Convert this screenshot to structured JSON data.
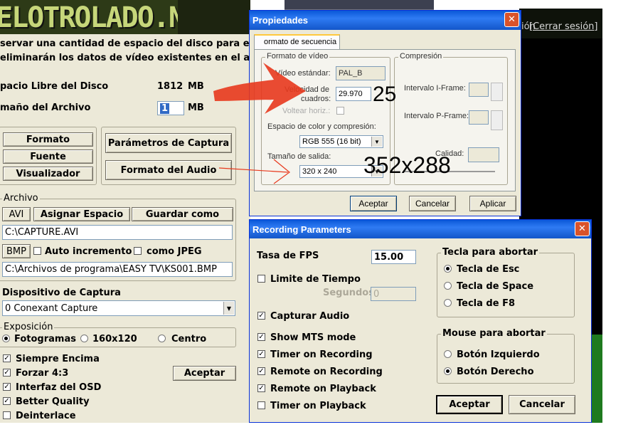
{
  "banner": {
    "text": "ELOTROLADO.NET"
  },
  "bg_link": {
    "prefix": "ión",
    "link": "[Cerrar sesión]"
  },
  "main": {
    "info_line1": "servar una cantidad de espacio del disco para el archivo",
    "info_line2": "eliminarán los datos de vídeo existentes en el archivo",
    "free_label": "pacio Libre del Disco",
    "free_value": "1812",
    "free_unit": "MB",
    "size_label": "maño del Archivo",
    "size_value": "1",
    "size_unit": "MB",
    "btn_formato": "Formato",
    "btn_fuente": "Fuente",
    "btn_visualizador": "Visualizador",
    "btn_parametros": "Parámetros de Captura",
    "btn_audio": "Formato del Audio",
    "archivo_label": "Archivo",
    "btn_avi": "AVI",
    "btn_asignar": "Asignar Espacio",
    "btn_guardar": "Guardar como",
    "avi_path": "C:\\CAPTURE.AVI",
    "btn_bmp": "BMP",
    "auto_label": "Auto incremento",
    "jpeg_label": "como JPEG",
    "bmp_path": "C:\\Archivos de programa\\EASY TV\\KS001.BMP",
    "device_label": "Dispositivo de Captura",
    "device_value": "0 Conexant Capture",
    "expo_label": "Exposición",
    "expo_opts": [
      "Fotogramas",
      "160x120",
      "Centro"
    ],
    "opts": [
      "Siempre Encima",
      "Forzar 4:3",
      "Interfaz del OSD",
      "Better Quality",
      "Deinterlace"
    ],
    "btn_aceptar": "Aceptar"
  },
  "props": {
    "title": "Propiedades",
    "close": "✕",
    "tab": "ormato de secuencia",
    "video_group": "Formato de vídeo",
    "std_label": "Vídeo estándar:",
    "std_value": "PAL_B",
    "fps_label1": "Velocidad de",
    "fps_label2": "cuadros:",
    "fps_value": "29.970",
    "flip_label": "Voltear horiz.:",
    "color_label": "Espacio de color y compresión:",
    "color_value": "RGB 555 (16 bit)",
    "size_label": "Tamaño de salida:",
    "size_value": "320 x 240",
    "comp_group": "Compresión",
    "iframe_label": "Intervalo I-Frame:",
    "pframe_label": "Intervalo P-Frame:",
    "quality_label": "Calidad:",
    "btn_ok": "Aceptar",
    "btn_cancel": "Cancelar",
    "btn_apply": "Aplicar"
  },
  "annot": {
    "fps": "25",
    "size": "352x288"
  },
  "rec": {
    "title": "Recording Parameters",
    "close": "✕",
    "fps_label": "Tasa de FPS",
    "fps_value": "15.00",
    "limit_label": "Limite de Tiempo",
    "seconds_label": "Segundos",
    "seconds_value": "0",
    "audio_label": "Capturar Audio",
    "checks": [
      "Show MTS mode",
      "Timer on Recording",
      "Remote on Recording",
      "Remote on Playback",
      "Timer on Playback"
    ],
    "abort_key_group": "Tecla para abortar",
    "abort_keys": [
      "Tecla de Esc",
      "Tecla de Space",
      "Tecla de F8"
    ],
    "abort_mouse_group": "Mouse para abortar",
    "abort_mouse": [
      "Botón Izquierdo",
      "Botón Derecho"
    ],
    "btn_ok": "Aceptar",
    "btn_cancel": "Cancelar"
  },
  "colors": {
    "banner": "#2d3a17",
    "dialog": "#ece9d8",
    "title": "#0a58d8",
    "arrow": "#e8391d"
  }
}
